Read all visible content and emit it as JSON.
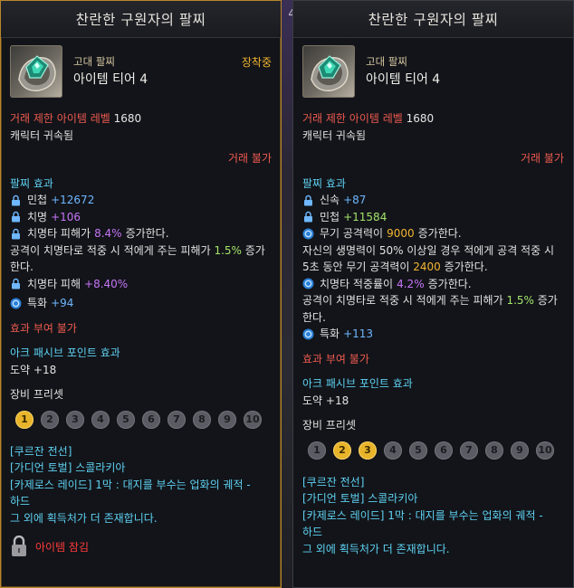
{
  "background": {
    "partial_number": "4"
  },
  "left": {
    "title": "찬란한 구원자의 팔찌",
    "grade": "고대 팔찌",
    "tier": "아이템 티어 4",
    "equipped": "장착중",
    "trade_level_label": "거래 제한 아이템 레벨",
    "trade_level_value": "1680",
    "bound": "캐릭터 귀속됨",
    "trade_status": "거래 불가",
    "effect_header": "팔찌 효과",
    "effects": {
      "e1_name": "민첩",
      "e1_val": "+12672",
      "e2_name": "치명",
      "e2_val": "+106",
      "e3_pre": "치명타 피해가",
      "e3_val": "8.4%",
      "e3_post": "증가한다.",
      "e4_pre": "공격이 치명타로 적중 시 적에게 주는 피해가",
      "e4_val": "1.5%",
      "e4_post": "증가",
      "e4_cont": "한다.",
      "e5_name": "치명타 피해",
      "e5_val": "+8.40%",
      "e6_name": "특화",
      "e6_val": "+94"
    },
    "no_enchant": "효과 부여 불가",
    "ark_header": "아크 패시브 포인트 효과",
    "ark_value": "도약 +18",
    "preset_header": "장비 프리셋",
    "presets": [
      "1",
      "2",
      "3",
      "4",
      "5",
      "6",
      "7",
      "8",
      "9",
      "10"
    ],
    "sources": [
      "[쿠르잔 전선]",
      "[가디언 토벌] 스콜라키아",
      "[카제로스 레이드] 1막 : 대지를 부수는 업화의 궤적 -",
      "하드",
      "그 외에 획득처가 더 존재합니다."
    ],
    "lock_text": "아이템 잠김"
  },
  "right": {
    "title": "찬란한 구원자의 팔찌",
    "grade": "고대 팔찌",
    "tier": "아이템 티어 4",
    "trade_level_label": "거래 제한 아이템 레벨",
    "trade_level_value": "1680",
    "bound": "캐릭터 귀속됨",
    "trade_status": "거래 불가",
    "effect_header": "팔찌 효과",
    "effects": {
      "e1_name": "신속",
      "e1_val": "+87",
      "e2_name": "민첩",
      "e2_val": "+11584",
      "e3_pre": "무기 공격력이",
      "e3_val": "9000",
      "e3_post": "증가한다.",
      "e4_line1": "자신의 생명력이 50% 이상일 경우 적에게 공격 적중 시",
      "e4_pre": "5초 동안 무기 공격력이",
      "e4_val": "2400",
      "e4_post": "증가한다.",
      "e5_pre": "치명타 적중률이",
      "e5_val": "4.2%",
      "e5_post": "증가한다.",
      "e6_pre": "공격이 치명타로 적중 시 적에게 주는 피해가",
      "e6_val": "1.5%",
      "e6_post": "증가",
      "e6_cont": "한다.",
      "e7_name": "특화",
      "e7_val": "+113"
    },
    "no_enchant": "효과 부여 불가",
    "ark_header": "아크 패시브 포인트 효과",
    "ark_value": "도약 +18",
    "preset_header": "장비 프리셋",
    "presets": [
      "1",
      "2",
      "3",
      "4",
      "5",
      "6",
      "7",
      "8",
      "9",
      "10"
    ],
    "sources": [
      "[쿠르잔 전선]",
      "[가디언 토벌] 스콜라키아",
      "[카제로스 레이드] 1막 : 대지를 부수는 업화의 궤적 -",
      "하드",
      "그 외에 획득처가 더 존재합니다."
    ]
  }
}
